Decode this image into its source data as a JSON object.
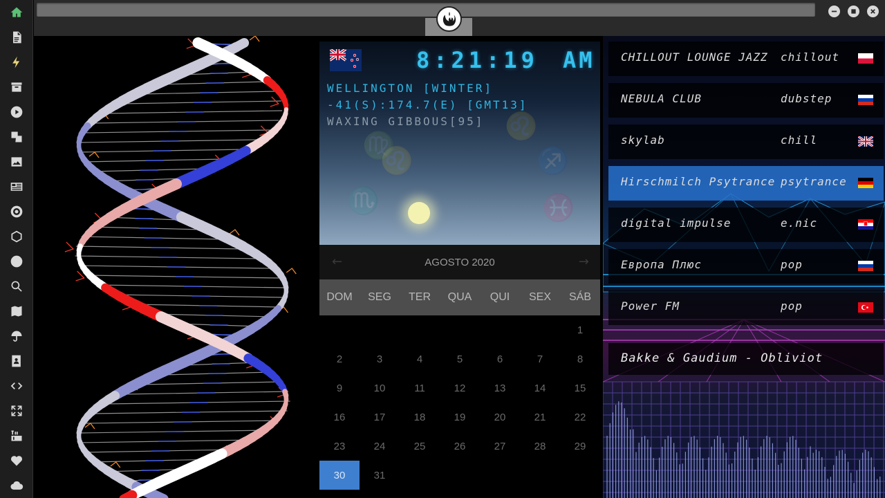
{
  "sidebar": {
    "items": [
      {
        "name": "home-icon"
      },
      {
        "name": "document-icon"
      },
      {
        "name": "bolt-icon"
      },
      {
        "name": "archive-icon"
      },
      {
        "name": "play-icon"
      },
      {
        "name": "translate-icon"
      },
      {
        "name": "image-icon"
      },
      {
        "name": "newspaper-icon"
      },
      {
        "name": "empire-icon"
      },
      {
        "name": "hexagon-network-icon"
      },
      {
        "name": "globe-icon"
      },
      {
        "name": "search-icon"
      },
      {
        "name": "map-icon"
      },
      {
        "name": "umbrella-icon"
      },
      {
        "name": "contacts-icon"
      },
      {
        "name": "code-icon"
      },
      {
        "name": "fullscreen-icon"
      },
      {
        "name": "youtube-icon"
      },
      {
        "name": "heart-icon"
      },
      {
        "name": "cloud-icon"
      }
    ]
  },
  "clock": {
    "time": "8:21:19",
    "ampm": "AM",
    "location": "WELLINGTON [WINTER]",
    "coords": "-41(S):174.7(E) [GMT13]",
    "moon": "WAXING GIBBOUS[95]"
  },
  "calendar": {
    "title": "AGOSTO 2020",
    "prev": "←",
    "next": "→",
    "days": [
      "DOM",
      "SEG",
      "TER",
      "QUA",
      "QUI",
      "SEX",
      "SÁB"
    ],
    "weeks": [
      [
        "",
        "",
        "",
        "",
        "",
        "",
        "1"
      ],
      [
        "2",
        "3",
        "4",
        "5",
        "6",
        "7",
        "8"
      ],
      [
        "9",
        "10",
        "11",
        "12",
        "13",
        "14",
        "15"
      ],
      [
        "16",
        "17",
        "18",
        "19",
        "20",
        "21",
        "22"
      ],
      [
        "23",
        "24",
        "25",
        "26",
        "27",
        "28",
        "29"
      ],
      [
        "30",
        "31",
        "",
        "",
        "",
        "",
        ""
      ]
    ],
    "today": "30"
  },
  "radio": {
    "stations": [
      {
        "name": "CHILLOUT LOUNGE JAZZ",
        "genre": "chillout",
        "flag": "poland"
      },
      {
        "name": "NEBULA CLUB",
        "genre": "dubstep",
        "flag": "russia"
      },
      {
        "name": "skylab",
        "genre": "chill",
        "flag": "uk"
      },
      {
        "name": "Hirschmilch Psytrance",
        "genre": "psytrance",
        "flag": "germany"
      },
      {
        "name": "digital impulse",
        "genre": "e.nic",
        "flag": "croatia"
      },
      {
        "name": "Европа Плюс",
        "genre": "pop",
        "flag": "russia"
      },
      {
        "name": "Power FM",
        "genre": "pop",
        "flag": "turkey"
      }
    ],
    "selected_index": 3,
    "now_playing": "Bakke & Gaudium - Obliviot"
  }
}
